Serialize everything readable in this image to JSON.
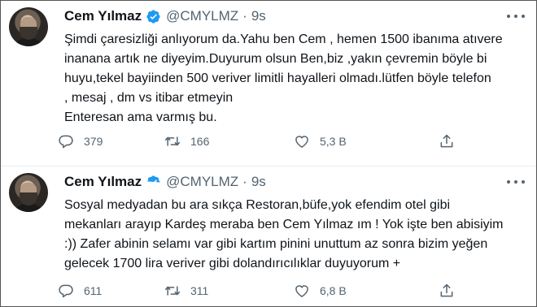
{
  "tweets": [
    {
      "author": {
        "name": "Cem Yılmaz",
        "handle": "@CMYLMZ",
        "separator": "·"
      },
      "time": "9s",
      "lines": [
        "Şimdi çaresizliği anlıyorum da.Yahu ben Cem , hemen 1500 ibanıma atıvere",
        "inanana artık ne diyeyim.Duyurum olsun Ben,biz ,yakın çevremin böyle bi",
        "huyu,tekel bayiinden 500 veriver limitli hayalleri olmadı.lütfen böyle telefon",
        ", mesaj , dm  vs itibar etmeyin",
        "Enteresan ama varmış bu."
      ],
      "stats": {
        "replies": "379",
        "retweets": "166",
        "likes": "5,3 B"
      }
    },
    {
      "author": {
        "name": "Cem Yılmaz",
        "handle": "@CMYLMZ",
        "separator": "·"
      },
      "time": "9s",
      "lines": [
        "Sosyal medyadan bu ara sıkça Restoran,büfe,yok efendim otel gibi",
        "mekanları arayıp Kardeş meraba ben Cem Yılmaz ım ! Yok işte ben abisiyim",
        ":)) Zafer abinin selamı var gibi kartım pinini unuttum az sonra bizim yeğen",
        "gelecek 1700 lira veriver gibi dolandırıcılıklar  duyuyorum +"
      ],
      "stats": {
        "replies": "611",
        "retweets": "311",
        "likes": "6,8 B"
      }
    }
  ],
  "icons": {
    "verified": "verified-badge-icon",
    "more": "more-options-icon",
    "reply": "reply-icon",
    "retweet": "retweet-icon",
    "like": "like-icon",
    "share": "share-icon"
  },
  "colors": {
    "verified": "#1d9bf0",
    "icon": "#536471",
    "text": "#0f1419"
  }
}
